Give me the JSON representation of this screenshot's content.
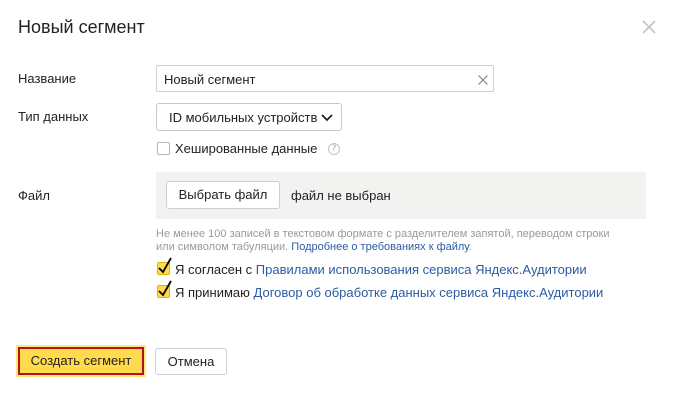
{
  "dialog": {
    "title": "Новый сегмент"
  },
  "form": {
    "name": {
      "label": "Название",
      "value": "Новый сегмент"
    },
    "data_type": {
      "label": "Тип данных",
      "selected": "ID мобильных устройств",
      "hashed_label": "Хешированные данные",
      "hashed_checked": false,
      "help_glyph": "?"
    },
    "file": {
      "label": "Файл",
      "choose_button": "Выбрать файл",
      "status": "файл не выбран",
      "hint_text": "Не менее 100 записей в текстовом формате с разделителем запятой, переводом строки или символом табуляции.",
      "hint_link": "Подробнее о требованиях к файлу",
      "hint_end": "."
    },
    "agreements": [
      {
        "prefix": "Я согласен с",
        "link": "Правилами использования сервиса Яндекс.Аудитории",
        "checked": true
      },
      {
        "prefix": "Я принимаю",
        "link": "Договор об обработке данных сервиса Яндекс.Аудитории",
        "checked": true
      }
    ]
  },
  "actions": {
    "create": "Создать сегмент",
    "cancel": "Отмена"
  },
  "colors": {
    "accent_yellow": "#ffdb4d",
    "link_blue": "#2b5ca3",
    "highlight_red": "#b3131c"
  }
}
